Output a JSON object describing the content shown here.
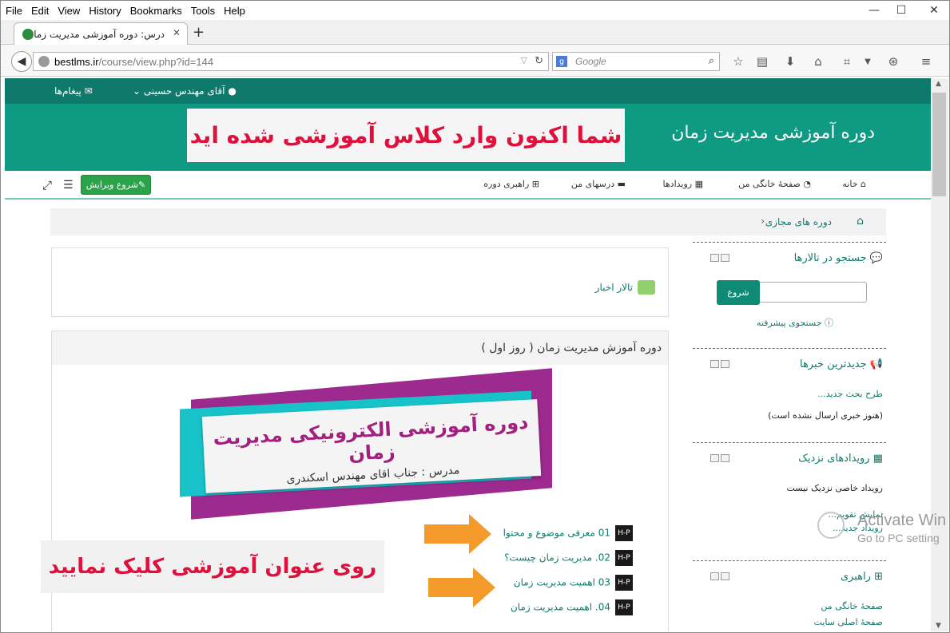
{
  "menubar": {
    "items": [
      "File",
      "Edit",
      "View",
      "History",
      "Bookmarks",
      "Tools",
      "Help"
    ]
  },
  "window": {
    "min": "—",
    "max": "☐",
    "close": "✕"
  },
  "tab": {
    "title": "درس: دوره آموزشی مدیریت زمان",
    "close": "✕",
    "new": "+"
  },
  "nav": {
    "url_host": "bestlms.ir",
    "url_path": "/course/view.php?id=144",
    "search_placeholder": "Google"
  },
  "topstrip": {
    "messages": "پیغام‌ها",
    "user": "آقای مهندس حسینی"
  },
  "header": {
    "site_name": "دوره آموزشی مدیریت زمان",
    "banner": "شما اکنون وارد کلاس آموزشی شده اید"
  },
  "navrow": {
    "items": [
      "خانه",
      "صفحهٔ خانگی من",
      "رویدادها",
      "درسهای من",
      "راهبری دوره"
    ],
    "edit": "شروع ویرایش"
  },
  "breadcrumb": {
    "item": "دوره های مجازی",
    "sep": "‹"
  },
  "blocks": {
    "search": {
      "title": "جستجو در تالارها",
      "button": "شروع",
      "advanced": "جستجوی پیشرفته"
    },
    "news": {
      "title": "جدیدترین خبرها",
      "add": "طرح بحث جدید...",
      "empty": "(هنوز خبری ارسال نشده است)"
    },
    "events": {
      "title": "رویدادهای نزدیک",
      "empty": "رویداد خاصی نزدیک نیست",
      "calendar": "نمایش تقویم...",
      "new": "رویداد جدید..."
    },
    "navigation": {
      "title": "راهبری",
      "home": "صفحهٔ خانگی من",
      "site": "صفحهٔ اصلی سایت"
    }
  },
  "main": {
    "forum": "تالار اخبار",
    "topic_title": "دوره آموزش مدیریت زمان ( روز اول )",
    "promo_title": "دوره آموزشی الکترونیکی مدیریت زمان",
    "promo_sub": "مدرس : جناب اقای مهندس اسکندری",
    "hp_icon": "H-P",
    "lessons": [
      "01 معرفی موضوع و محتوا",
      "02. مدیریت زمان چیست؟",
      "03 اهمیت مدیریت زمان",
      "04. اهمیت مدیریت زمان"
    ],
    "instruction": "روی عنوان آموزشی کلیک نمایید"
  },
  "watermark": {
    "line1": "Activate Win",
    "line2": "Go to PC setting"
  },
  "colors": {
    "accent": "#0f9a83",
    "dark_accent": "#0f7a6b",
    "highlight_text": "#e0103d",
    "edit_button": "#2aa34a",
    "arrow": "#f39a2b"
  }
}
